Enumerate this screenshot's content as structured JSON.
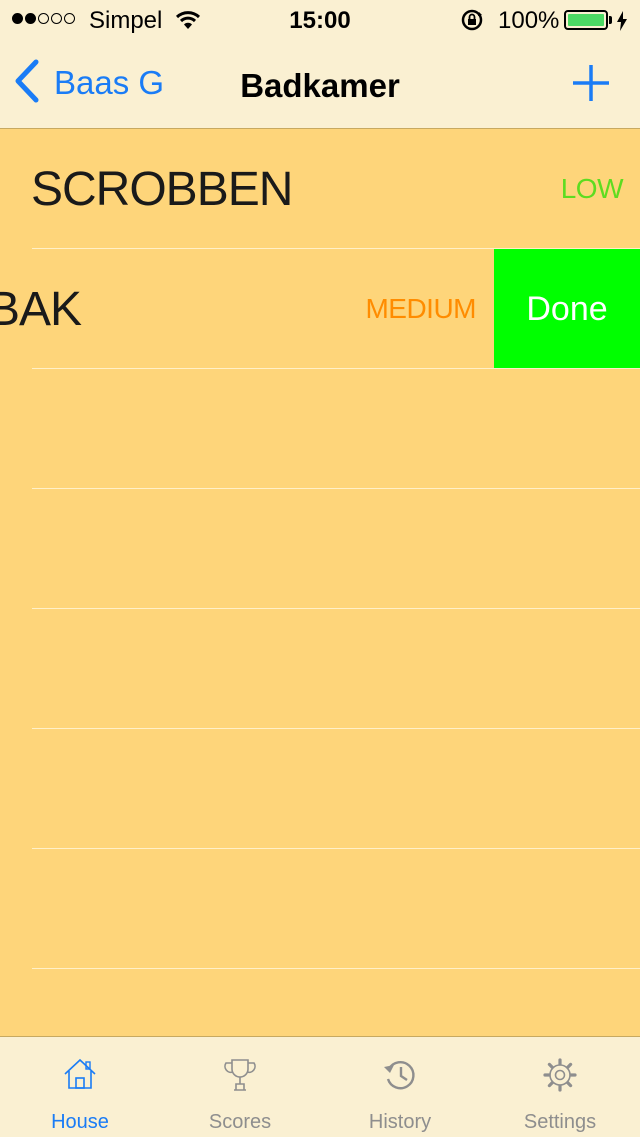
{
  "status_bar": {
    "carrier": "Simpel",
    "time": "15:00",
    "battery": "100%",
    "battery_color": "#4cd964"
  },
  "nav": {
    "back_label": "Baas G",
    "title": "Badkamer",
    "tint_color": "#1a7cf6"
  },
  "tasks": [
    {
      "name": "SCROBBEN",
      "priority": "LOW",
      "priority_color": "#5edc20"
    },
    {
      "name": "BAK",
      "priority": "MEDIUM",
      "priority_color": "#ff8c00",
      "action_label": "Done",
      "action_color": "#00ff00"
    }
  ],
  "tab_bar": {
    "tabs": [
      {
        "label": "House",
        "icon": "house-icon",
        "active": true
      },
      {
        "label": "Scores",
        "icon": "trophy-icon",
        "active": false
      },
      {
        "label": "History",
        "icon": "history-icon",
        "active": false
      },
      {
        "label": "Settings",
        "icon": "gear-icon",
        "active": false
      }
    ]
  },
  "colors": {
    "background": "#fed57a",
    "bars": "#faf0d2"
  }
}
